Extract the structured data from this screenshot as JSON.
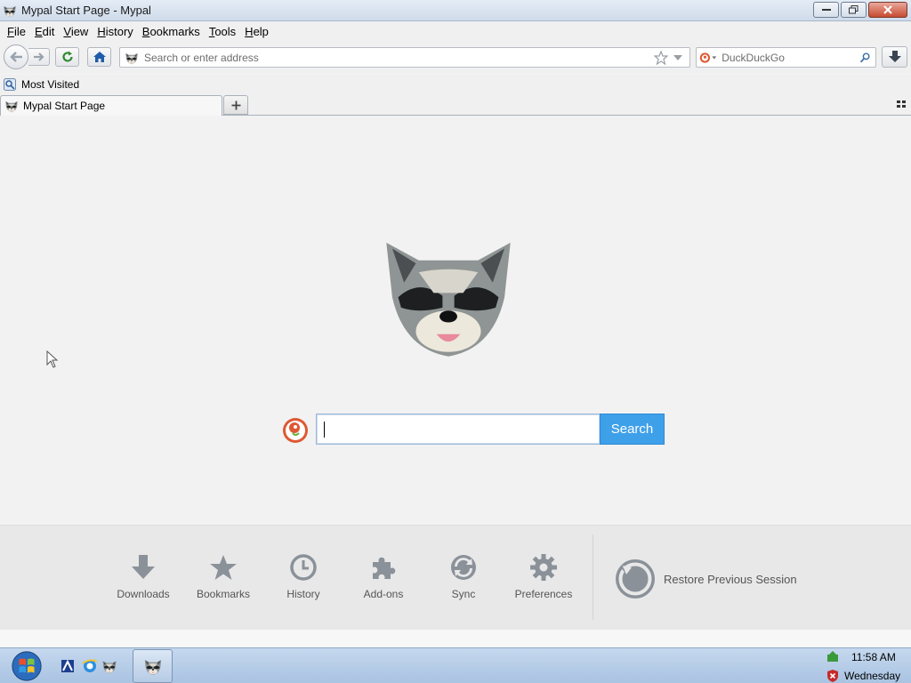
{
  "window": {
    "title": "Mypal Start Page - Mypal"
  },
  "menubar": {
    "items": [
      {
        "label": "File",
        "accel": "F",
        "rest": "ile"
      },
      {
        "label": "Edit",
        "accel": "E",
        "rest": "dit"
      },
      {
        "label": "View",
        "accel": "V",
        "rest": "iew"
      },
      {
        "label": "History",
        "accel": "H",
        "rest": "istory"
      },
      {
        "label": "Bookmarks",
        "accel": "B",
        "rest": "ookmarks"
      },
      {
        "label": "Tools",
        "accel": "T",
        "rest": "ools"
      },
      {
        "label": "Help",
        "accel": "H",
        "rest": "elp"
      }
    ]
  },
  "navbar": {
    "url_placeholder": "Search or enter address",
    "search_engine": "DuckDuckGo"
  },
  "bookmarks": {
    "most_visited": "Most Visited"
  },
  "tabs": [
    {
      "title": "Mypal Start Page"
    }
  ],
  "start_page": {
    "search_button": "Search",
    "launcher": [
      {
        "label": "Downloads",
        "icon": "download-icon"
      },
      {
        "label": "Bookmarks",
        "icon": "star-icon"
      },
      {
        "label": "History",
        "icon": "clock-icon"
      },
      {
        "label": "Add-ons",
        "icon": "puzzle-icon"
      },
      {
        "label": "Sync",
        "icon": "sync-icon"
      },
      {
        "label": "Preferences",
        "icon": "gear-icon"
      }
    ],
    "restore_session": "Restore Previous Session"
  },
  "taskbar": {
    "time": "11:58 AM",
    "day": "Wednesday"
  },
  "colors": {
    "search_button": "#3fa0ea",
    "launcher_icon": "#8a9199"
  }
}
